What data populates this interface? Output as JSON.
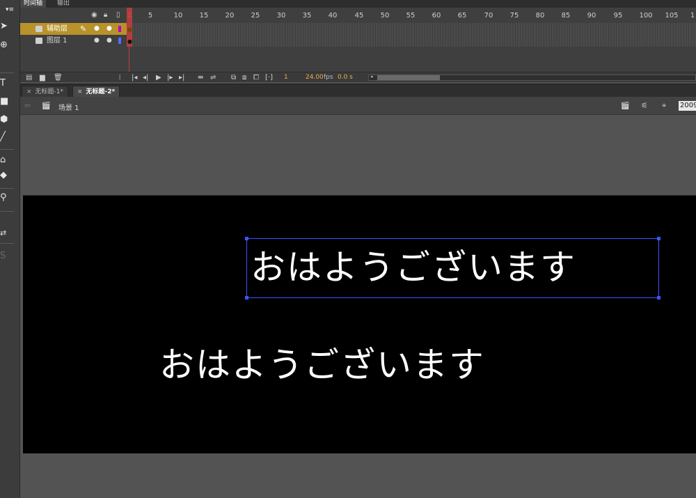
{
  "timeline": {
    "tabs": [
      "时间轴",
      "输出"
    ],
    "ruler": [
      "1",
      "5",
      "10",
      "15",
      "20",
      "25",
      "30",
      "35",
      "40",
      "45",
      "50",
      "55",
      "60",
      "65",
      "70",
      "75",
      "80",
      "85",
      "90",
      "95",
      "100",
      "105",
      "1"
    ],
    "layers": [
      {
        "name": "辅助层",
        "color": "#c000c0"
      },
      {
        "name": "图层 1",
        "color": "#5a6cff"
      }
    ],
    "current_frame": "1",
    "fps": "24.00",
    "fps_unit": "fps",
    "time": "0.0 s"
  },
  "documents": {
    "tabs": [
      {
        "label": "无标题-1*",
        "close": "×"
      },
      {
        "label": "无标题-2*",
        "close": "×"
      }
    ]
  },
  "editbar": {
    "scene": "场景 1",
    "zoom": "2009"
  },
  "stage": {
    "text_selected": "おはようございます",
    "text_plain": "おはようございます",
    "selection_color": "#3a56ff"
  },
  "tools": {
    "text_tool": "T",
    "faded_tool": "S"
  }
}
